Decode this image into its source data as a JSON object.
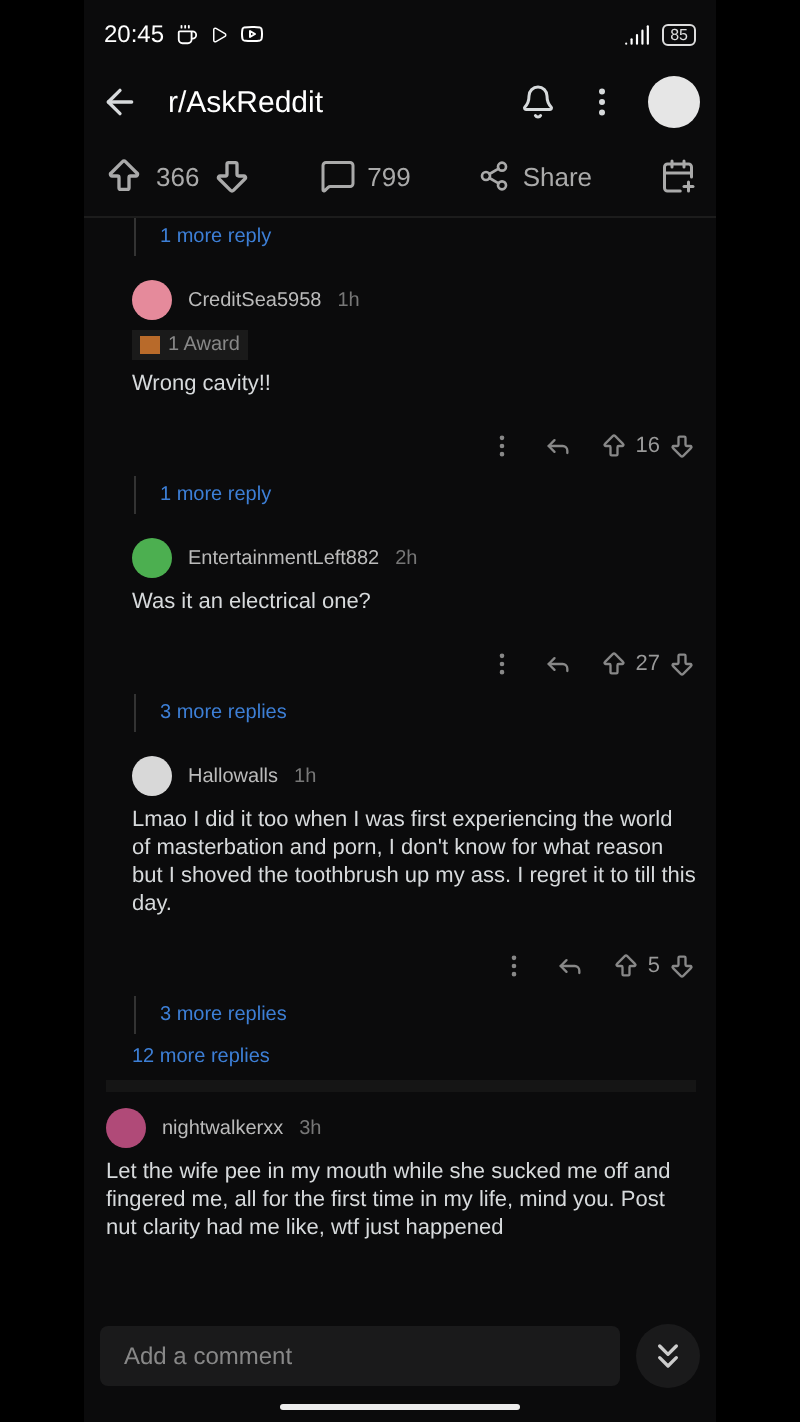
{
  "status_bar": {
    "time": "20:45",
    "battery": "85"
  },
  "header": {
    "title": "r/AskReddit"
  },
  "post_actions": {
    "votes": "366",
    "comments": "799",
    "share": "Share"
  },
  "thread": [
    {
      "kind": "reply_link",
      "text": "1 more reply"
    },
    {
      "kind": "comment",
      "author": "CreditSea5958",
      "age": "1h",
      "award": "1 Award",
      "body": "Wrong cavity!!",
      "votes": "16",
      "color": "#e58a9b"
    },
    {
      "kind": "reply_link",
      "text": "1 more reply"
    },
    {
      "kind": "comment",
      "author": "EntertainmentLeft882",
      "age": "2h",
      "body": "Was it an electrical one?",
      "votes": "27",
      "color": "#4caf50"
    },
    {
      "kind": "reply_link",
      "text": "3 more replies"
    },
    {
      "kind": "comment",
      "author": "Hallowalls",
      "age": "1h",
      "body": "Lmao I did it too when I was first experiencing the world of masterbation and porn, I don't know for what reason but I shoved the toothbrush up my ass. I regret it to till this day.",
      "votes": "5",
      "color": "#d8d8d8"
    },
    {
      "kind": "reply_link",
      "text": "3 more replies"
    },
    {
      "kind": "thread_link",
      "text": "12 more replies"
    },
    {
      "kind": "top_comment",
      "author": "nightwalkerxx",
      "age": "3h",
      "body": "Let the wife pee in my mouth while she sucked me off and fingered me, all for the first time in my life, mind you. Post nut clarity had me like, wtf just happened",
      "color": "#b04a78"
    }
  ],
  "composer": {
    "placeholder": "Add a comment"
  }
}
